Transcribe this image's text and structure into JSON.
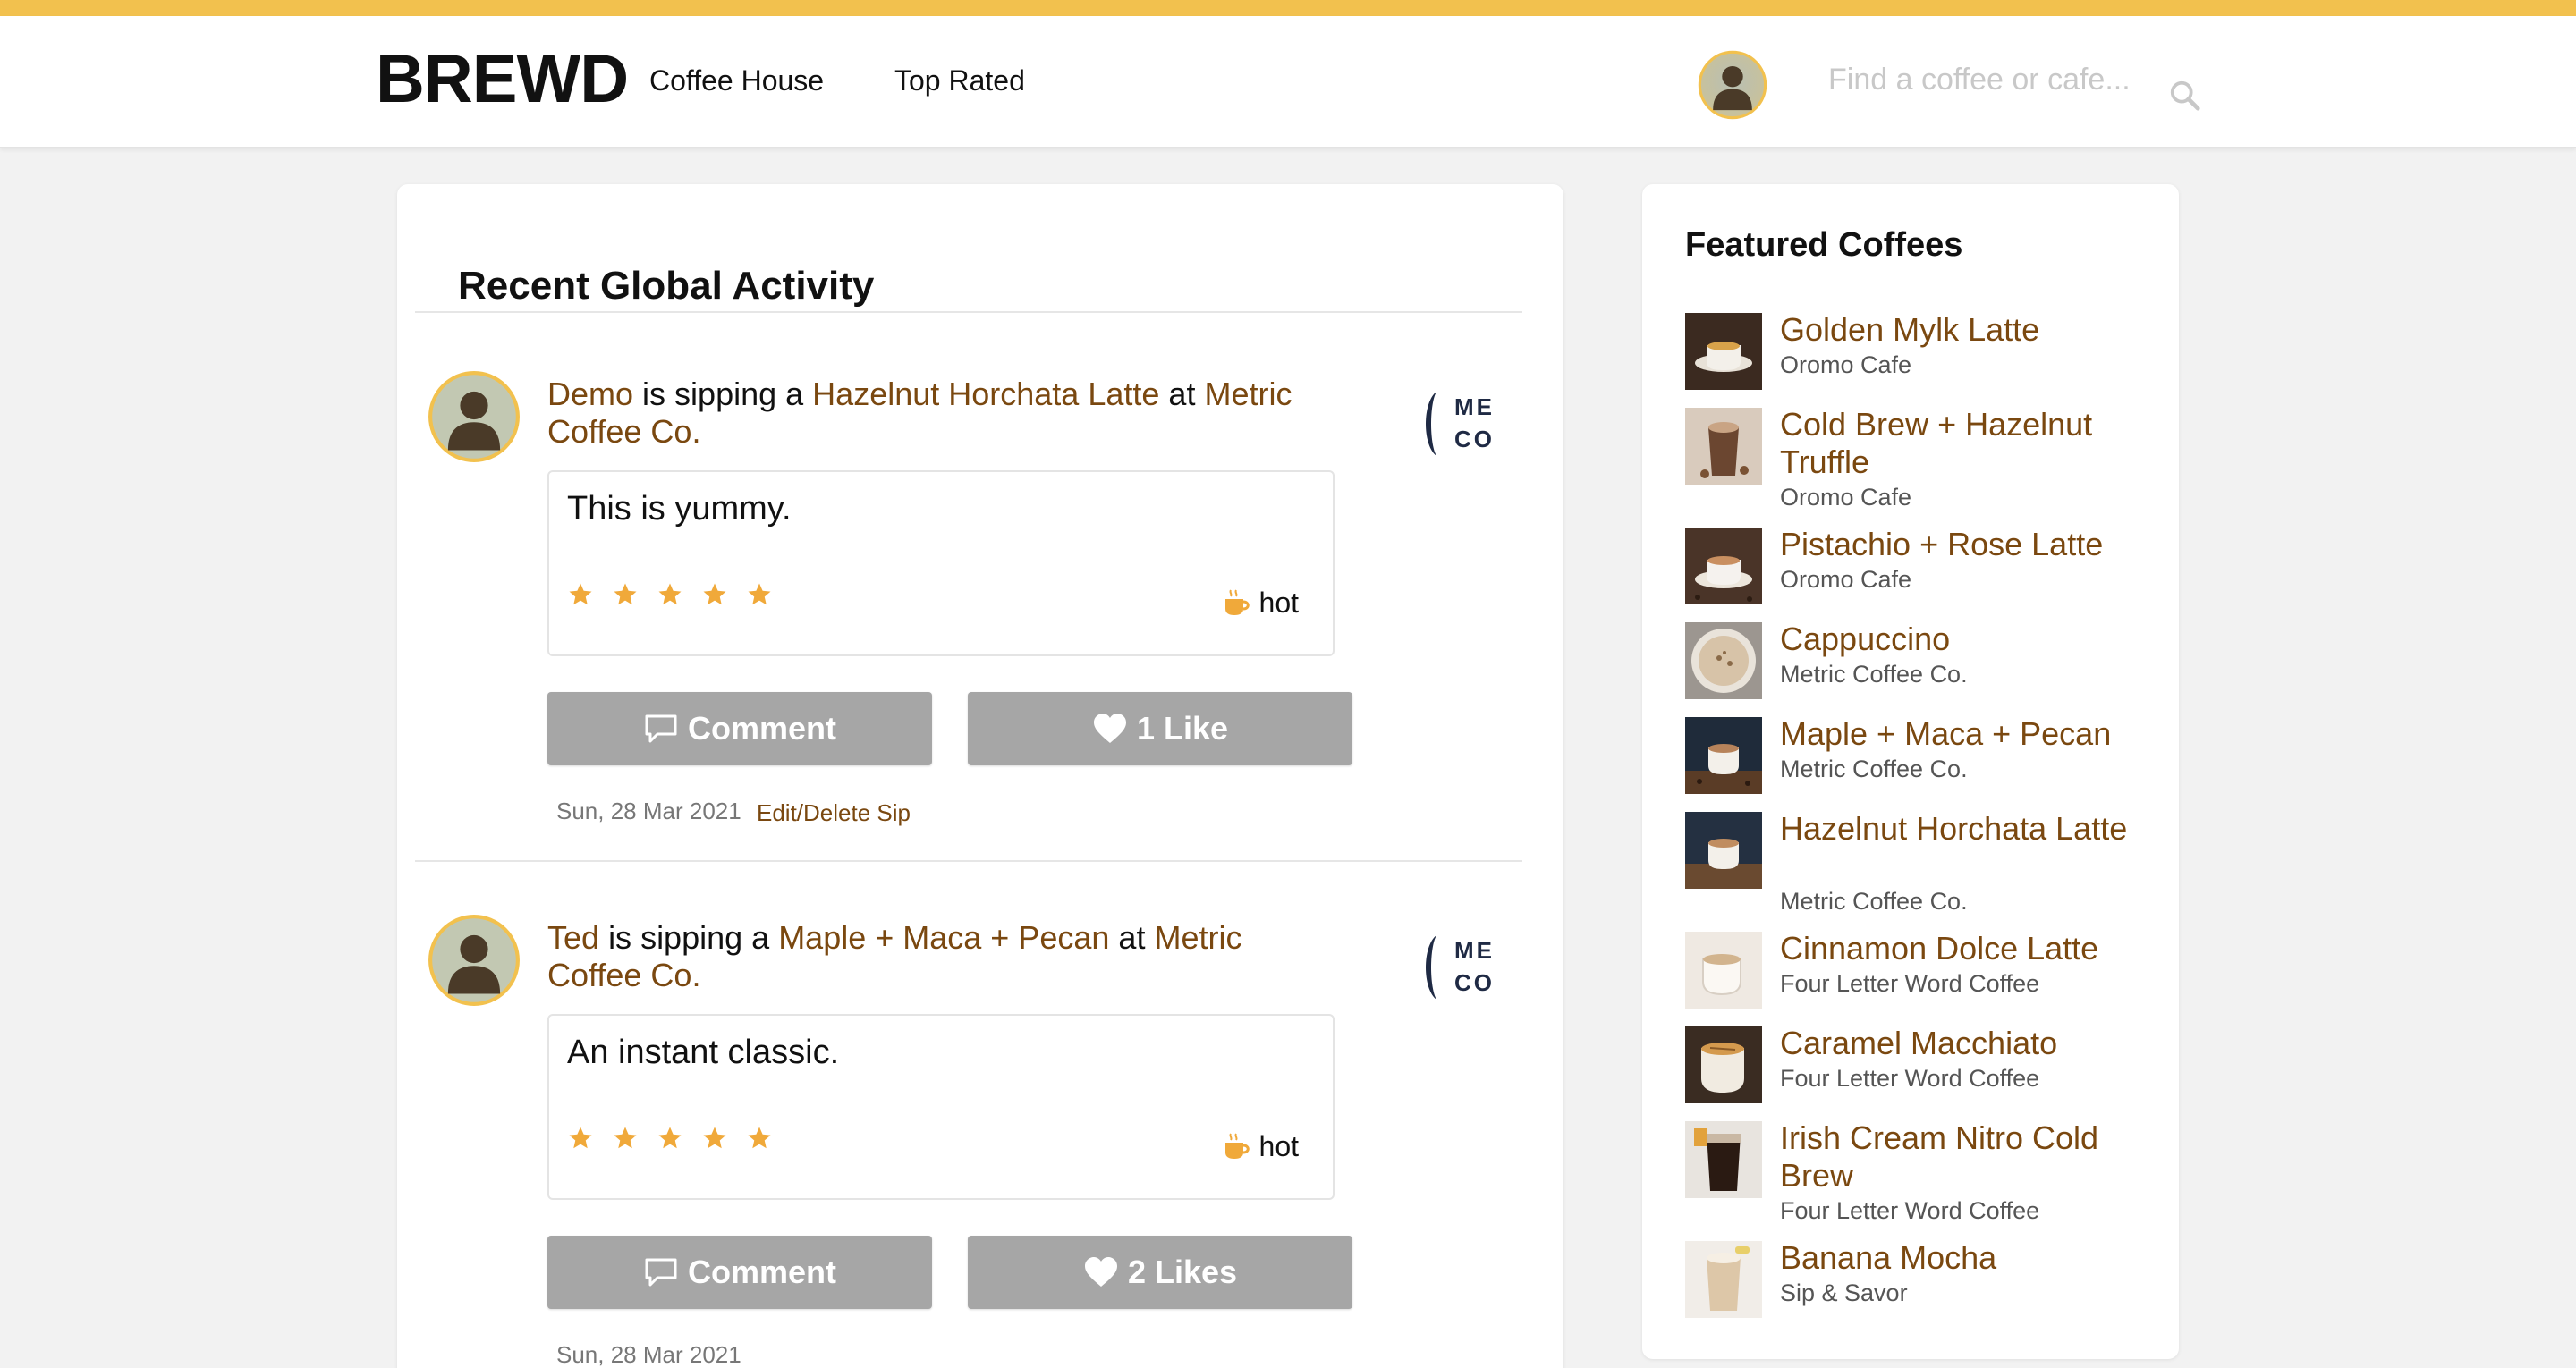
{
  "header": {
    "logo": "BREWD",
    "nav": [
      "Coffee House",
      "Top Rated"
    ],
    "search_placeholder": "Find a coffee or cafe..."
  },
  "feed": {
    "title": "Recent Global Activity",
    "sips": [
      {
        "user": "Demo",
        "verb": "is sipping a",
        "coffee": "Hazelnut Horchata Latte",
        "at": "at",
        "cafe": "Metric Coffee Co.",
        "review": "This is yummy.",
        "rating": 5,
        "temperature": "hot",
        "comment_label": "Comment",
        "like_label": "1 Like",
        "date": "Sun, 28 Mar 2021",
        "edit_label": "Edit/Delete Sip",
        "cafe_logo_lines": [
          "ME",
          "CO"
        ]
      },
      {
        "user": "Ted",
        "verb": "is sipping a",
        "coffee": "Maple + Maca + Pecan",
        "at": "at",
        "cafe": "Metric Coffee Co.",
        "review": "An instant classic.",
        "rating": 5,
        "temperature": "hot",
        "comment_label": "Comment",
        "like_label": "2 Likes",
        "date": "Sun, 28 Mar 2021",
        "cafe_logo_lines": [
          "ME",
          "CO"
        ]
      }
    ]
  },
  "sidebar": {
    "title": "Featured Coffees",
    "coffees": [
      {
        "name": "Golden Mylk Latte",
        "cafe": "Oromo Cafe"
      },
      {
        "name": "Cold Brew + Hazelnut Truffle",
        "cafe": "Oromo Cafe"
      },
      {
        "name": "Pistachio + Rose Latte",
        "cafe": "Oromo Cafe"
      },
      {
        "name": "Cappuccino",
        "cafe": "Metric Coffee Co."
      },
      {
        "name": "Maple + Maca + Pecan",
        "cafe": "Metric Coffee Co."
      },
      {
        "name": "Hazelnut Horchata Latte",
        "cafe": "Metric Coffee Co."
      },
      {
        "name": "Cinnamon Dolce Latte",
        "cafe": "Four Letter Word Coffee"
      },
      {
        "name": "Caramel Macchiato",
        "cafe": "Four Letter Word Coffee"
      },
      {
        "name": "Irish Cream Nitro Cold Brew",
        "cafe": "Four Letter Word Coffee"
      },
      {
        "name": "Banana Mocha",
        "cafe": "Sip & Savor"
      }
    ]
  },
  "colors": {
    "accent_stripe": "#f2c14e",
    "link": "#7a4810",
    "star": "#f0a93a",
    "button": "#a6a6a6",
    "avatar_ring": "#f2c14e",
    "avatar_figure": "#4a3a28"
  },
  "icons": {
    "search": "search-icon",
    "comment": "speech-bubble-icon",
    "like": "heart-icon",
    "rating": "star-icon",
    "temperature": "coffee-cup-icon",
    "avatar": "user-silhouette-icon"
  }
}
